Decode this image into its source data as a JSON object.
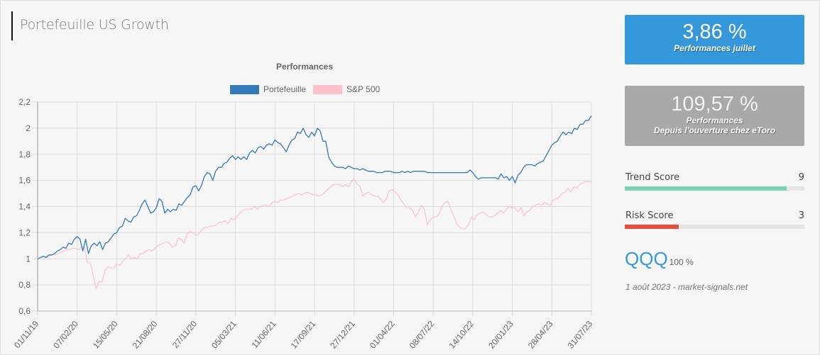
{
  "page": {
    "title": "Portefeuille US Growth"
  },
  "cards": {
    "monthly": {
      "value": "3,86 %",
      "label": "Performances juillet",
      "color": "#3498db"
    },
    "total": {
      "value": "109,57 %",
      "label_line1": "Performances",
      "label_line2": "Depuis l'ouverture chez eToro",
      "color": "#a9a9a9"
    }
  },
  "scores": {
    "trend": {
      "label": "Trend Score",
      "value": "9",
      "fraction": 0.9,
      "color": "#7dd3b6"
    },
    "risk": {
      "label": "Risk Score",
      "value": "3",
      "fraction": 0.3,
      "color": "#e74c3c"
    }
  },
  "allocation": {
    "ticker": "QQQ",
    "weight": "100 %"
  },
  "footer": {
    "note": "1 août 2023 - market-signals.net"
  },
  "chart_data": {
    "type": "line",
    "title": "Performances",
    "xlabel": "",
    "ylabel": "",
    "ylim": [
      0.6,
      2.2
    ],
    "yticks": [
      "0,6",
      "0,8",
      "1",
      "1,2",
      "1,4",
      "1,6",
      "1,8",
      "2",
      "2,2"
    ],
    "ytick_values": [
      0.6,
      0.8,
      1.0,
      1.2,
      1.4,
      1.6,
      1.8,
      2.0,
      2.2
    ],
    "xticks": [
      "01/11/19",
      "07/02/20",
      "15/05/20",
      "21/08/20",
      "27/11/20",
      "05/03/21",
      "11/06/21",
      "17/09/21",
      "27/12/21",
      "01/04/22",
      "08/07/22",
      "14/10/22",
      "20/01/23",
      "28/04/23",
      "31/07/23"
    ],
    "grid": true,
    "legend_position": "top-center",
    "series": [
      {
        "name": "Portefeuille",
        "color": "#337ab7",
        "values": [
          1.0,
          1.01,
          1.02,
          1.01,
          1.03,
          1.03,
          1.04,
          1.06,
          1.07,
          1.09,
          1.08,
          1.12,
          1.11,
          1.15,
          1.17,
          1.15,
          1.06,
          1.15,
          1.04,
          1.1,
          1.12,
          1.1,
          1.13,
          1.07,
          1.12,
          1.13,
          1.16,
          1.19,
          1.2,
          1.24,
          1.25,
          1.31,
          1.29,
          1.28,
          1.32,
          1.33,
          1.37,
          1.42,
          1.45,
          1.4,
          1.35,
          1.36,
          1.39,
          1.46,
          1.44,
          1.35,
          1.38,
          1.36,
          1.38,
          1.37,
          1.42,
          1.41,
          1.44,
          1.47,
          1.49,
          1.55,
          1.56,
          1.52,
          1.56,
          1.63,
          1.66,
          1.65,
          1.6,
          1.67,
          1.7,
          1.7,
          1.73,
          1.74,
          1.77,
          1.79,
          1.76,
          1.78,
          1.76,
          1.78,
          1.76,
          1.81,
          1.83,
          1.81,
          1.85,
          1.86,
          1.84,
          1.87,
          1.88,
          1.87,
          1.91,
          1.89,
          1.88,
          1.85,
          1.82,
          1.87,
          1.91,
          1.92,
          1.97,
          1.96,
          2.0,
          1.95,
          1.93,
          1.97,
          1.94,
          2.0,
          1.98,
          1.9,
          1.9,
          1.78,
          1.74,
          1.71,
          1.7,
          1.7,
          1.7,
          1.69,
          1.71,
          1.7,
          1.69,
          1.69,
          1.68,
          1.69,
          1.68,
          1.67,
          1.67,
          1.67,
          1.66,
          1.66,
          1.66,
          1.67,
          1.67,
          1.67,
          1.66,
          1.66,
          1.66,
          1.67,
          1.66,
          1.67,
          1.66,
          1.67,
          1.67,
          1.67,
          1.67,
          1.67,
          1.66,
          1.66,
          1.66,
          1.66,
          1.66,
          1.66,
          1.66,
          1.66,
          1.66,
          1.66,
          1.66,
          1.66,
          1.66,
          1.66,
          1.66,
          1.68,
          1.66,
          1.63,
          1.61,
          1.62,
          1.62,
          1.62,
          1.62,
          1.62,
          1.62,
          1.61,
          1.65,
          1.62,
          1.63,
          1.6,
          1.63,
          1.58,
          1.64,
          1.66,
          1.7,
          1.72,
          1.72,
          1.72,
          1.71,
          1.73,
          1.74,
          1.75,
          1.79,
          1.83,
          1.87,
          1.89,
          1.9,
          1.94,
          1.97,
          1.95,
          1.97,
          1.96,
          2.0,
          1.99,
          2.03,
          2.03,
          2.06,
          2.06
        ],
        "final_value": 2.0957
      },
      {
        "name": "S&P 500",
        "color": "#ffc0cb",
        "values": [
          1.0,
          1.01,
          1.02,
          1.01,
          1.02,
          1.03,
          1.03,
          1.04,
          1.05,
          1.06,
          1.07,
          1.07,
          1.08,
          1.08,
          1.07,
          1.09,
          1.09,
          0.97,
          0.97,
          0.87,
          0.77,
          0.83,
          0.82,
          0.91,
          0.94,
          0.93,
          0.93,
          0.96,
          0.95,
          0.98,
          1.0,
          1.03,
          1.0,
          1.01,
          1.0,
          1.04,
          1.04,
          1.06,
          1.07,
          1.06,
          1.08,
          1.1,
          1.11,
          1.12,
          1.13,
          1.12,
          1.09,
          1.1,
          1.16,
          1.15,
          1.12,
          1.19,
          1.21,
          1.2,
          1.18,
          1.19,
          1.22,
          1.24,
          1.24,
          1.25,
          1.25,
          1.26,
          1.28,
          1.28,
          1.29,
          1.27,
          1.31,
          1.3,
          1.32,
          1.35,
          1.37,
          1.38,
          1.38,
          1.38,
          1.4,
          1.38,
          1.4,
          1.41,
          1.41,
          1.4,
          1.43,
          1.44,
          1.43,
          1.45,
          1.45,
          1.46,
          1.47,
          1.48,
          1.49,
          1.5,
          1.49,
          1.5,
          1.51,
          1.5,
          1.49,
          1.49,
          1.48,
          1.49,
          1.51,
          1.53,
          1.55,
          1.57,
          1.57,
          1.57,
          1.55,
          1.57,
          1.55,
          1.59,
          1.61,
          1.57,
          1.56,
          1.48,
          1.5,
          1.51,
          1.49,
          1.48,
          1.48,
          1.46,
          1.43,
          1.46,
          1.52,
          1.53,
          1.51,
          1.49,
          1.45,
          1.42,
          1.39,
          1.39,
          1.37,
          1.32,
          1.36,
          1.41,
          1.38,
          1.26,
          1.3,
          1.32,
          1.32,
          1.34,
          1.4,
          1.43,
          1.44,
          1.38,
          1.33,
          1.27,
          1.24,
          1.23,
          1.23,
          1.26,
          1.32,
          1.3,
          1.34,
          1.35,
          1.36,
          1.34,
          1.32,
          1.32,
          1.33,
          1.35,
          1.37,
          1.35,
          1.38,
          1.4,
          1.39,
          1.39,
          1.36,
          1.39,
          1.33,
          1.36,
          1.37,
          1.4,
          1.41,
          1.42,
          1.41,
          1.43,
          1.42,
          1.41,
          1.45,
          1.46,
          1.47,
          1.5,
          1.51,
          1.54,
          1.51,
          1.55,
          1.54,
          1.57,
          1.58,
          1.59,
          1.59
        ],
        "final_value": 1.59
      }
    ]
  }
}
